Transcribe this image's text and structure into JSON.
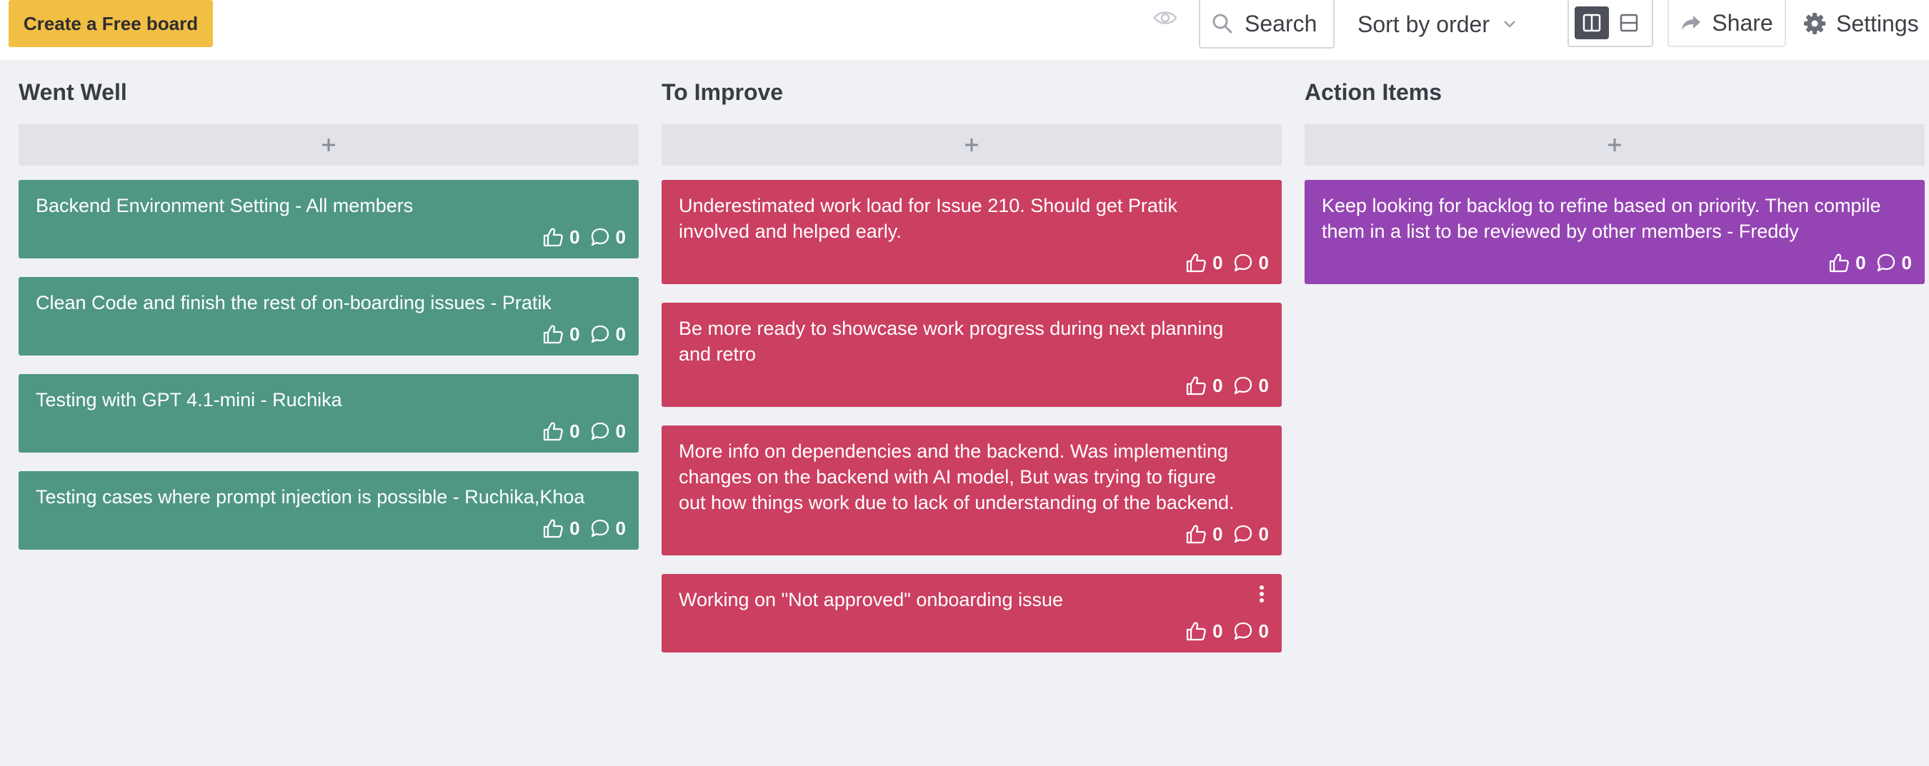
{
  "header": {
    "free_board_label": "Create a Free board",
    "search_label": "Search",
    "sort_label": "Sort by order",
    "share_label": "Share",
    "settings_label": "Settings"
  },
  "colors": {
    "accent": "#f2bf45",
    "went_well": "#4f9784",
    "to_improve": "#cb3f60",
    "action_items": "#9545b3"
  },
  "columns": [
    {
      "title": "Went Well",
      "cards": [
        {
          "text": "Backend Environment Setting - All members",
          "likes": "0",
          "comments": "0"
        },
        {
          "text": "Clean Code and finish the rest of on-boarding issues - Pratik",
          "likes": "0",
          "comments": "0"
        },
        {
          "text": "Testing with GPT 4.1-mini - Ruchika",
          "likes": "0",
          "comments": "0"
        },
        {
          "text": "Testing cases where prompt injection is possible - Ruchika,Khoa",
          "likes": "0",
          "comments": "0"
        }
      ]
    },
    {
      "title": "To Improve",
      "cards": [
        {
          "text": "Underestimated work load for Issue 210. Should get Pratik involved and helped early.",
          "likes": "0",
          "comments": "0"
        },
        {
          "text": "Be more ready to showcase work progress during next planning and retro",
          "likes": "0",
          "comments": "0"
        },
        {
          "text": "More info on dependencies and the backend. Was implementing changes on the backend with AI model, But was trying to figure out how things work due to lack of understanding of the backend.",
          "likes": "0",
          "comments": "0"
        },
        {
          "text": "Working on \"Not approved\" onboarding issue",
          "likes": "0",
          "comments": "0"
        }
      ]
    },
    {
      "title": "Action Items",
      "cards": [
        {
          "text": "Keep looking for backlog to refine based on priority. Then compile them in a list to be reviewed by other members - Freddy",
          "likes": "0",
          "comments": "0"
        }
      ]
    }
  ]
}
